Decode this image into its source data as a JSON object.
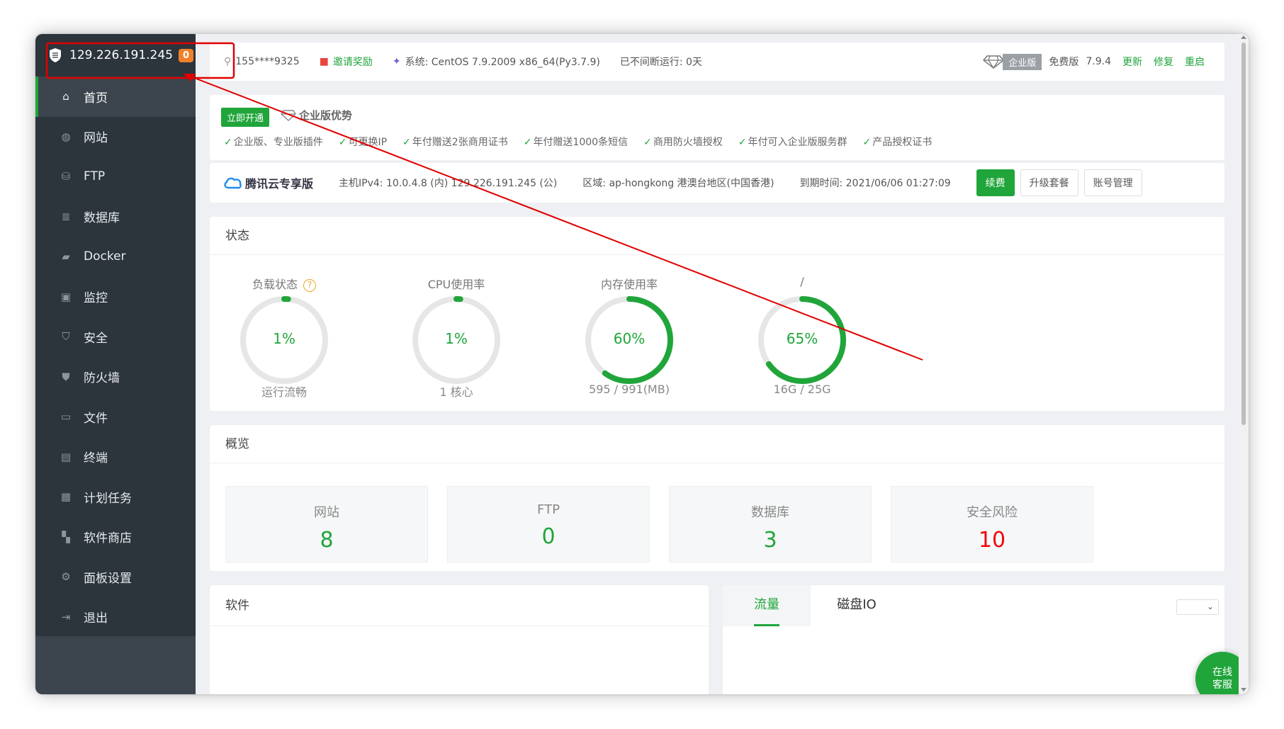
{
  "sidebar": {
    "server_ip": "129.226.191.245",
    "badge": "0",
    "items": [
      {
        "label": "首页",
        "icon": "home-icon"
      },
      {
        "label": "网站",
        "icon": "globe-icon"
      },
      {
        "label": "FTP",
        "icon": "ftp-icon"
      },
      {
        "label": "数据库",
        "icon": "database-icon"
      },
      {
        "label": "Docker",
        "icon": "docker-icon"
      },
      {
        "label": "监控",
        "icon": "monitor-icon"
      },
      {
        "label": "安全",
        "icon": "shield-check-icon"
      },
      {
        "label": "防火墙",
        "icon": "firewall-icon"
      },
      {
        "label": "文件",
        "icon": "folder-icon"
      },
      {
        "label": "终端",
        "icon": "terminal-icon"
      },
      {
        "label": "计划任务",
        "icon": "calendar-icon"
      },
      {
        "label": "软件商店",
        "icon": "apps-icon"
      },
      {
        "label": "面板设置",
        "icon": "gear-icon"
      },
      {
        "label": "退出",
        "icon": "logout-icon"
      }
    ]
  },
  "topbar": {
    "user": "155****9325",
    "invite": "邀请奖励",
    "system": "系统:  CentOS 7.9.2009 x86_64(Py3.7.9)",
    "uptime": "已不间断运行: 0天",
    "edition_tag": "企业版",
    "free": "免费版",
    "version": "7.9.4",
    "update": "更新",
    "repair": "修复",
    "restart": "重启"
  },
  "promo": {
    "open_button": "立即开通",
    "advantage": "企业版优势",
    "features": [
      "企业版、专业版插件",
      "可更换IP",
      "年付赠送2张商用证书",
      "年付赠送1000条短信",
      "商用防火墙授权",
      "年付可入企业版服务群",
      "产品授权证书"
    ]
  },
  "tencent": {
    "brand": "腾讯云专享版",
    "ipv4": "主机IPv4:  10.0.4.8 (内)  129.226.191.245 (公)",
    "region": "区域:  ap-hongkong 港澳台地区(中国香港)",
    "expire": "到期时间:  2021/06/06 01:27:09",
    "renew": "续费",
    "upgrade": "升级套餐",
    "account": "账号管理"
  },
  "status": {
    "title": "状态",
    "gauges": [
      {
        "name": "负载状态",
        "value": "1%",
        "percent": 1,
        "sub": "运行流畅",
        "help": "?"
      },
      {
        "name": "CPU使用率",
        "value": "1%",
        "percent": 1,
        "sub": "1 核心"
      },
      {
        "name": "内存使用率",
        "value": "60%",
        "percent": 60,
        "sub": "595 / 991(MB)"
      },
      {
        "name": "/",
        "value": "65%",
        "percent": 65,
        "sub": "16G / 25G"
      }
    ]
  },
  "overview": {
    "title": "概览",
    "boxes": [
      {
        "label": "网站",
        "value": "8"
      },
      {
        "label": "FTP",
        "value": "0"
      },
      {
        "label": "数据库",
        "value": "3"
      },
      {
        "label": "安全风险",
        "value": "10"
      }
    ]
  },
  "software": {
    "title": "软件"
  },
  "traffic": {
    "tab_flow": "流量",
    "tab_disk": "磁盘IO"
  },
  "chat": {
    "line1": "在线",
    "line2": "客服"
  },
  "colors": {
    "accent": "#20a53a",
    "sidebar": "#2c343c",
    "danger": "#ef0808",
    "annotation": "#e00000"
  }
}
